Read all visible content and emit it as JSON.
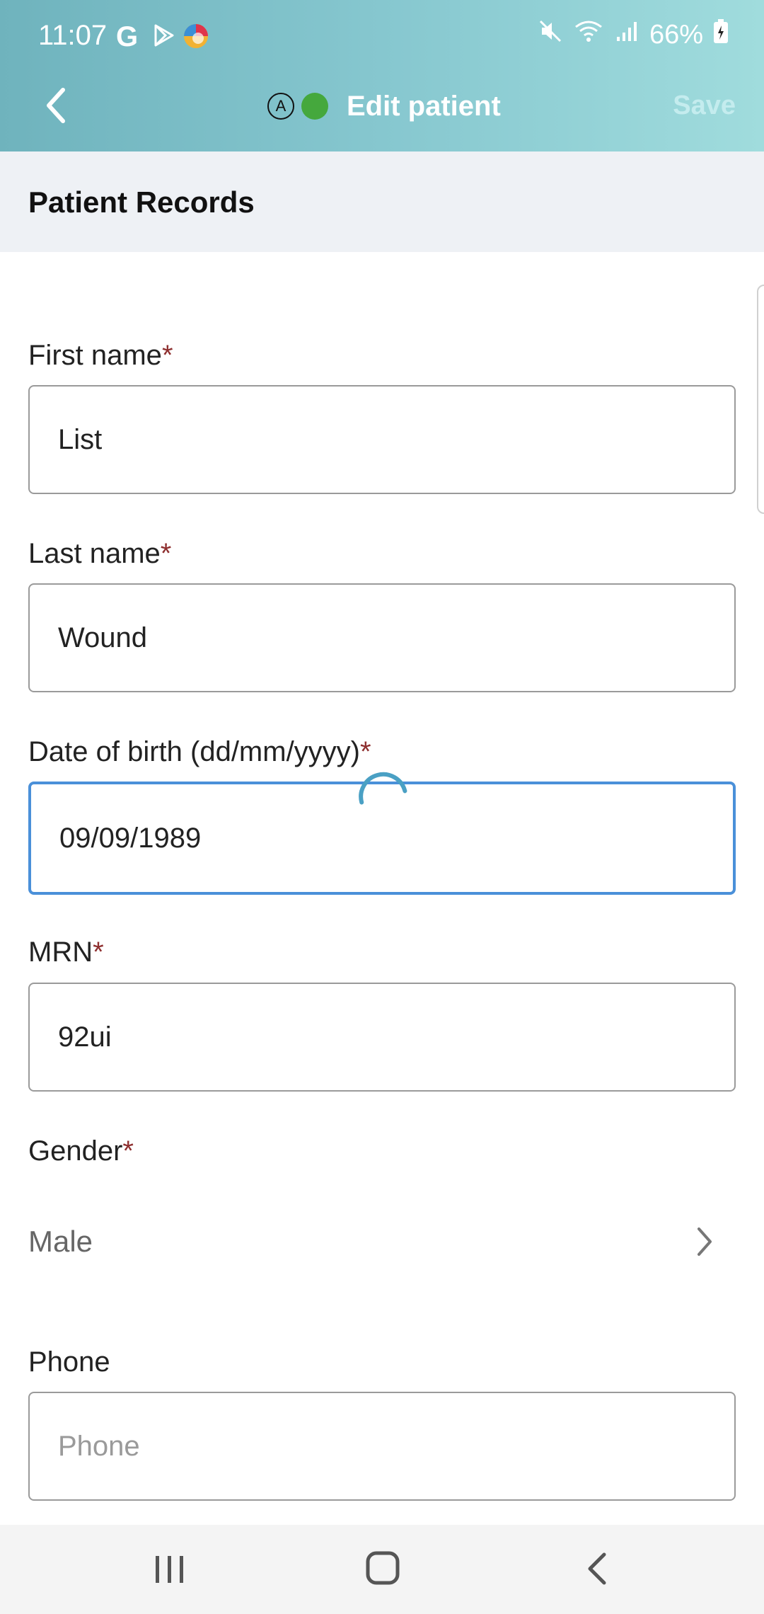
{
  "status_bar": {
    "time": "11:07",
    "g_letter": "G",
    "battery": "66%"
  },
  "app_bar": {
    "badge_letter": "A",
    "title": "Edit patient",
    "save_label": "Save"
  },
  "section": {
    "title": "Patient Records"
  },
  "form": {
    "required_mark": "*",
    "first_name": {
      "label": "First name",
      "value": "List"
    },
    "last_name": {
      "label": "Last name",
      "value": "Wound"
    },
    "dob": {
      "label": "Date of birth (dd/mm/yyyy)",
      "value": "09/09/1989"
    },
    "mrn": {
      "label": "MRN",
      "value": "92ui"
    },
    "gender": {
      "label": "Gender",
      "value": "Male"
    },
    "phone": {
      "label": "Phone",
      "placeholder": "Phone",
      "value": ""
    }
  },
  "colors": {
    "header_start": "#6fb3bd",
    "header_end": "#a0dcdd",
    "required": "#8e2f2f",
    "focus_border": "#4a90d9",
    "status_dot": "#45a83d"
  },
  "icons": {
    "back": "chevron-left-icon",
    "gender_select": "chevron-right-icon",
    "nav_recents": "recents-icon",
    "nav_home": "home-icon",
    "nav_back": "back-icon"
  }
}
